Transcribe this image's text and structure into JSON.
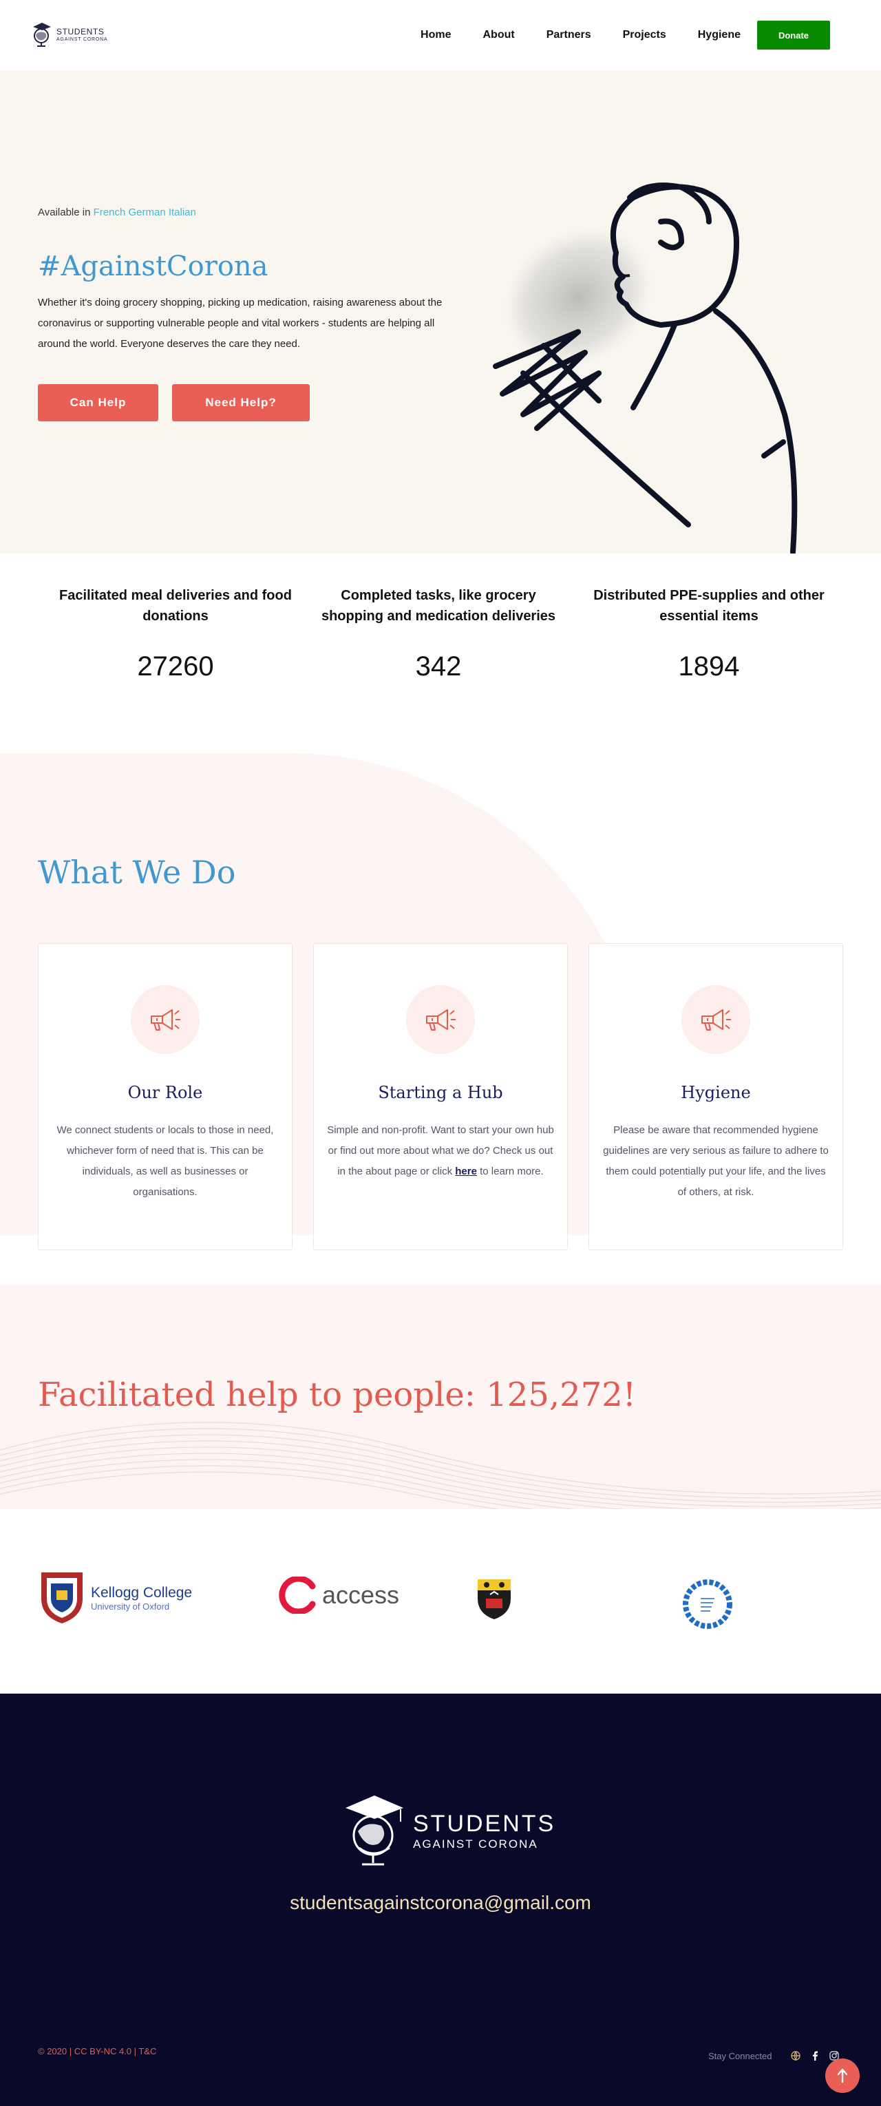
{
  "header": {
    "logo_line1": "STUDENTS",
    "logo_line2": "AGAINST CORONA",
    "nav": [
      "Home",
      "About",
      "Partners",
      "Projects",
      "Hygiene"
    ],
    "donate_label": "Donate"
  },
  "hero": {
    "available_prefix": "Available in",
    "languages": "French German Italian",
    "title": "#AgainstCorona",
    "text": "Whether it's doing grocery shopping, picking up medication, raising awareness about the coronavirus or supporting vulnerable people and vital workers - students are helping all around the world. Everyone deserves the care they need.",
    "button_can_help": "Can Help",
    "button_need_help": "Need Help?"
  },
  "stats": [
    {
      "label": "Facilitated meal deliveries and food donations",
      "value": "27260"
    },
    {
      "label": "Completed tasks, like grocery shopping and medication deliveries",
      "value": "342"
    },
    {
      "label": "Distributed PPE-supplies and other essential items",
      "value": "1894"
    }
  ],
  "what_we_do": {
    "title": "What We Do",
    "cards": [
      {
        "title": "Our Role",
        "text": "We connect students or locals to those in need, whichever form of need that is. This can be individuals, as well as businesses or organisations.",
        "icon": "megaphone-icon"
      },
      {
        "title": "Starting a Hub",
        "text_before": "Simple and non-profit. Want to start your own hub or find out more about what we do? Check us out in the about page or click",
        "link": "here",
        "text_after": "to learn more.",
        "icon": "megaphone-icon"
      },
      {
        "title": "Hygiene",
        "text": "Please be aware that recommended hygiene guidelines are very serious as failure to adhere to them could potentially put your life, and the lives of others, at risk.",
        "icon": "megaphone-icon"
      }
    ]
  },
  "helped": {
    "title": "Facilitated help to people: 125,272!"
  },
  "partners": {
    "kellogg_name": "Kellogg College",
    "kellogg_sub": "University of Oxford",
    "access_name": "access"
  },
  "footer": {
    "logo_line1": "STUDENTS",
    "logo_line2": "AGAINST CORONA",
    "email": "studentsagainstcorona@gmail.com",
    "copyright": "© 2020 | CC BY-NC 4.0 | T&C",
    "stay_connected": "Stay Connected",
    "socials": [
      "globe-icon",
      "facebook-icon",
      "instagram-icon"
    ]
  },
  "colors": {
    "accent_blue": "#3f98d2",
    "coral": "#ea5f55",
    "donate_green": "#0a8a00",
    "navy": "#090929",
    "hero_bg": "#f9f6ef"
  }
}
